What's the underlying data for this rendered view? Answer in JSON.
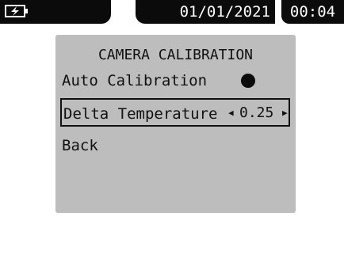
{
  "status_bar": {
    "battery_icon": "battery-charging-icon",
    "date": "01/01/2021",
    "time": "00:04"
  },
  "menu": {
    "title": "CAMERA CALIBRATION",
    "items": [
      {
        "label": "Auto Calibration",
        "state": "on"
      },
      {
        "label": "Delta Temperature",
        "value": "0.25",
        "selected": true
      },
      {
        "label": "Back"
      }
    ]
  },
  "colors": {
    "bar": "#0b0b0b",
    "panel": "#bdbdbd",
    "background": "#ffffff"
  }
}
